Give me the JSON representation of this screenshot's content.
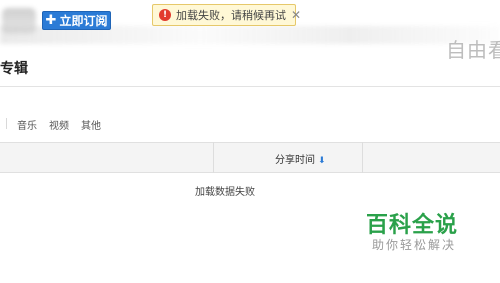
{
  "header": {
    "subscribe_label": "立即订阅",
    "subscribe_icon": "plus-icon",
    "watermark_text": "自由看"
  },
  "toast": {
    "icon": "error-icon",
    "message": "加载失败，请稍候再试",
    "close_icon": "close-icon"
  },
  "page": {
    "title": "专辑"
  },
  "filters": {
    "items": [
      "音乐",
      "视频",
      "其他"
    ]
  },
  "table": {
    "columns": [
      {
        "label": "分享时间",
        "sort_icon": "sort-down-arrow-icon"
      }
    ],
    "empty_message": "加载数据失败"
  },
  "logo": {
    "main": "百科全说",
    "sub": "助你轻松解决"
  },
  "colors": {
    "button_blue": "#2b7bd6",
    "toast_bg": "#fff8d6",
    "error_red": "#e23b2e",
    "logo_green": "#2aa14a"
  }
}
